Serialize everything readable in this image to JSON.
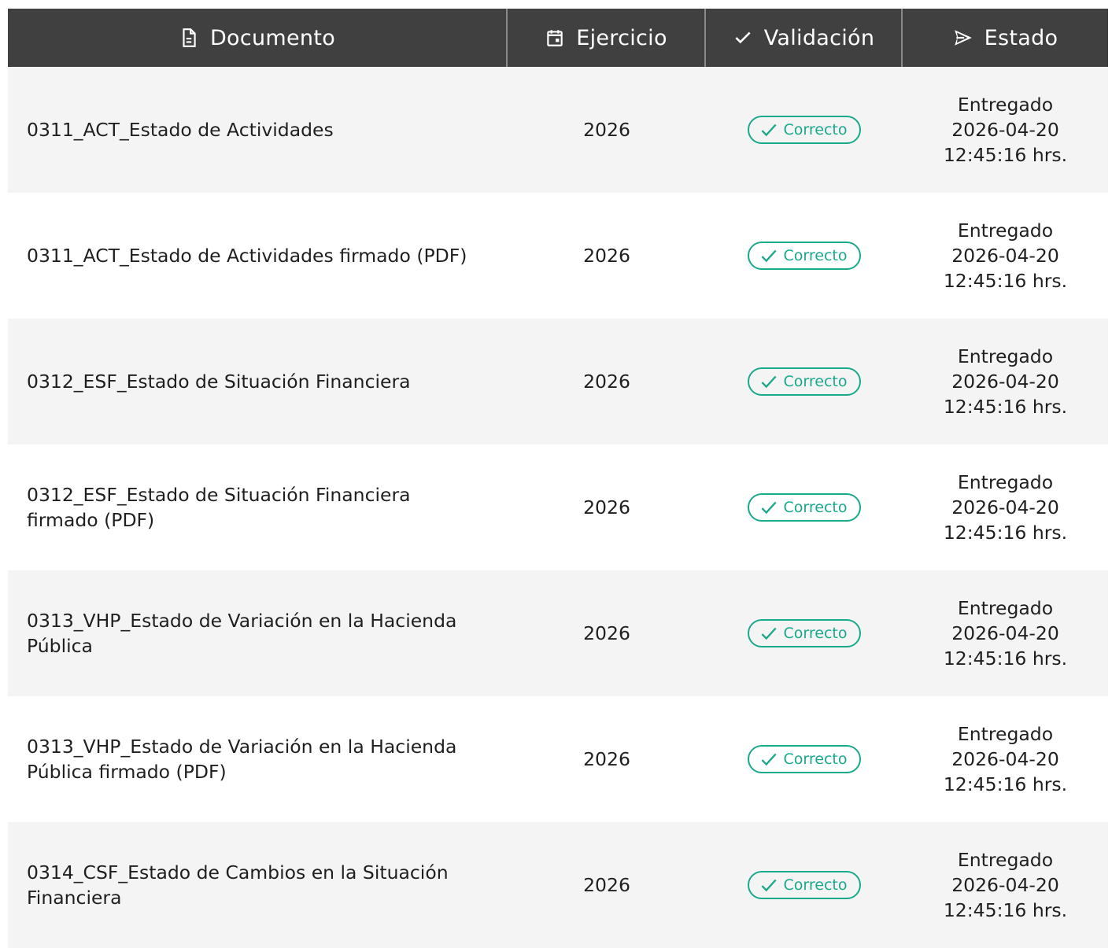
{
  "header": {
    "columns": [
      {
        "label": "Documento",
        "icon": "document-icon"
      },
      {
        "label": "Ejercicio",
        "icon": "calendar-icon"
      },
      {
        "label": "Validación",
        "icon": "check-icon"
      },
      {
        "label": "Estado",
        "icon": "send-icon"
      }
    ]
  },
  "colors": {
    "header_bg": "#404040",
    "badge": "#19a98c",
    "row_alt": "#f4f4f4"
  },
  "rows": [
    {
      "documento": "0311_ACT_Estado de Actividades",
      "ejercicio": "2026",
      "validacion": "Correcto",
      "estado": [
        "Entregado",
        "2026-04-20",
        "12:45:16 hrs."
      ]
    },
    {
      "documento": "0311_ACT_Estado de Actividades firmado (PDF)",
      "ejercicio": "2026",
      "validacion": "Correcto",
      "estado": [
        "Entregado",
        "2026-04-20",
        "12:45:16 hrs."
      ]
    },
    {
      "documento": "0312_ESF_Estado de Situación Financiera",
      "ejercicio": "2026",
      "validacion": "Correcto",
      "estado": [
        "Entregado",
        "2026-04-20",
        "12:45:16 hrs."
      ]
    },
    {
      "documento": "0312_ESF_Estado de Situación Financiera firmado (PDF)",
      "ejercicio": "2026",
      "validacion": "Correcto",
      "estado": [
        "Entregado",
        "2026-04-20",
        "12:45:16 hrs."
      ]
    },
    {
      "documento": "0313_VHP_Estado de Variación en la Hacienda Pública",
      "ejercicio": "2026",
      "validacion": "Correcto",
      "estado": [
        "Entregado",
        "2026-04-20",
        "12:45:16 hrs."
      ]
    },
    {
      "documento": "0313_VHP_Estado de Variación en la Hacienda Pública firmado (PDF)",
      "ejercicio": "2026",
      "validacion": "Correcto",
      "estado": [
        "Entregado",
        "2026-04-20",
        "12:45:16 hrs."
      ]
    },
    {
      "documento": "0314_CSF_Estado de Cambios en la Situación Financiera",
      "ejercicio": "2026",
      "validacion": "Correcto",
      "estado": [
        "Entregado",
        "2026-04-20",
        "12:45:16 hrs."
      ]
    }
  ]
}
